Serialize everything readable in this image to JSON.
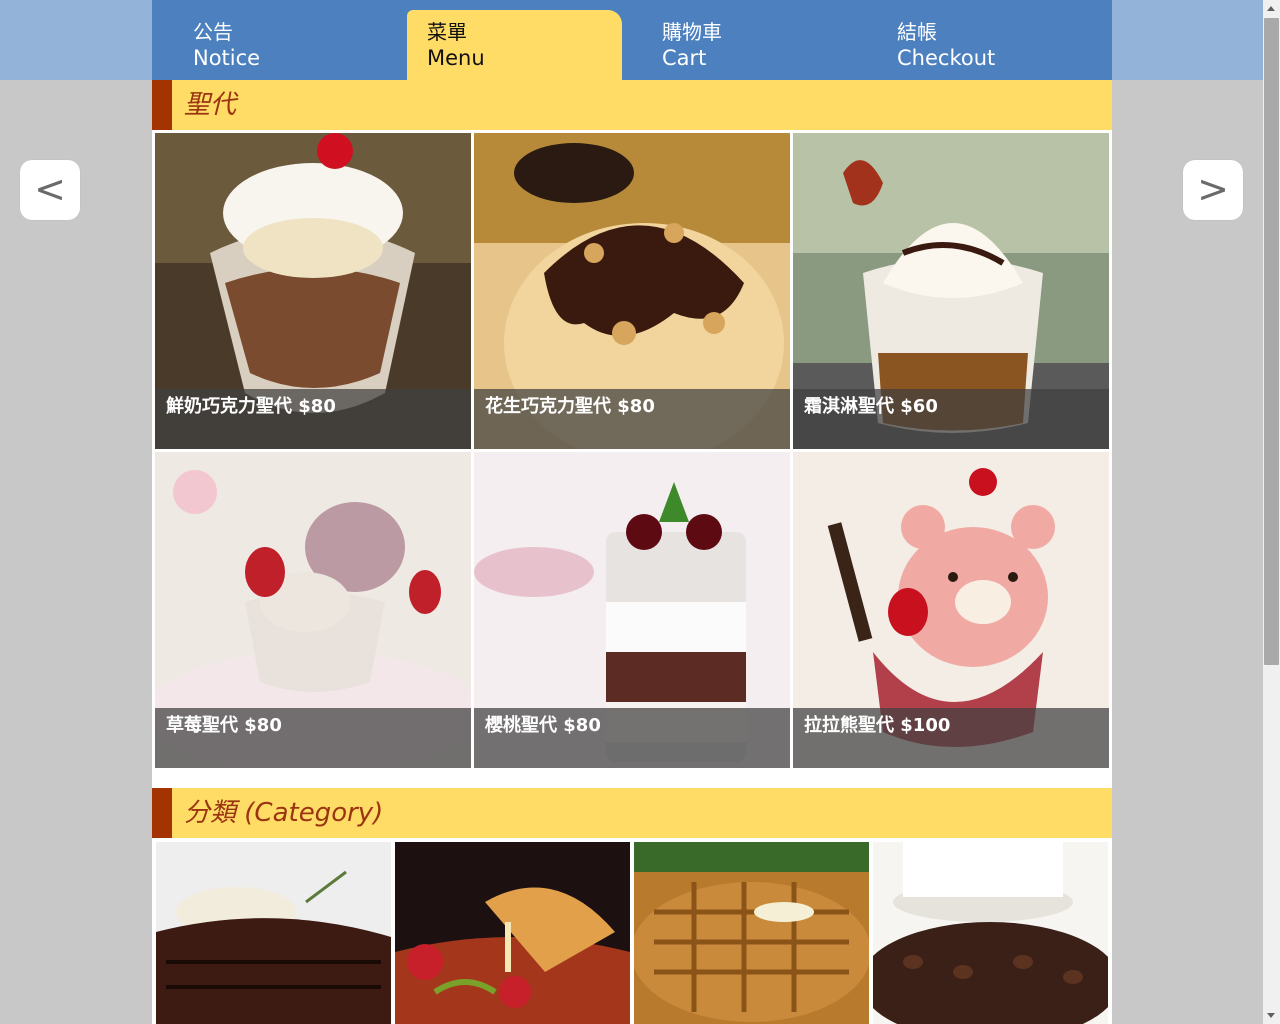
{
  "nav": {
    "tabs": [
      {
        "zh": "公告",
        "en": "Notice"
      },
      {
        "zh": "菜單",
        "en": "Menu"
      },
      {
        "zh": "購物車",
        "en": "Cart"
      },
      {
        "zh": "結帳",
        "en": "Checkout"
      }
    ],
    "active_index": 1
  },
  "arrows": {
    "prev": "<",
    "next": ">"
  },
  "sundae_section": {
    "title": "聖代",
    "items": [
      {
        "caption": "鮮奶巧克力聖代 $80",
        "icon": "sundae-photo"
      },
      {
        "caption": "花生巧克力聖代 $80",
        "icon": "sundae-photo"
      },
      {
        "caption": "霜淇淋聖代 $60",
        "icon": "sundae-photo"
      },
      {
        "caption": "草莓聖代 $80",
        "icon": "sundae-photo"
      },
      {
        "caption": "櫻桃聖代 $80",
        "icon": "sundae-photo"
      },
      {
        "caption": "拉拉熊聖代 $100",
        "icon": "sundae-photo"
      }
    ]
  },
  "category_section": {
    "title": "分類 (Category)",
    "items": [
      {
        "icon": "steak-photo"
      },
      {
        "icon": "pizza-photo"
      },
      {
        "icon": "waffle-photo"
      },
      {
        "icon": "coffee-photo"
      }
    ]
  },
  "colors": {
    "nav_bg": "#4d80bf",
    "top_band": "#93b3d8",
    "active_tab": "#ffdc66",
    "section_bar": "#a33300",
    "section_title": "#9a3411"
  }
}
